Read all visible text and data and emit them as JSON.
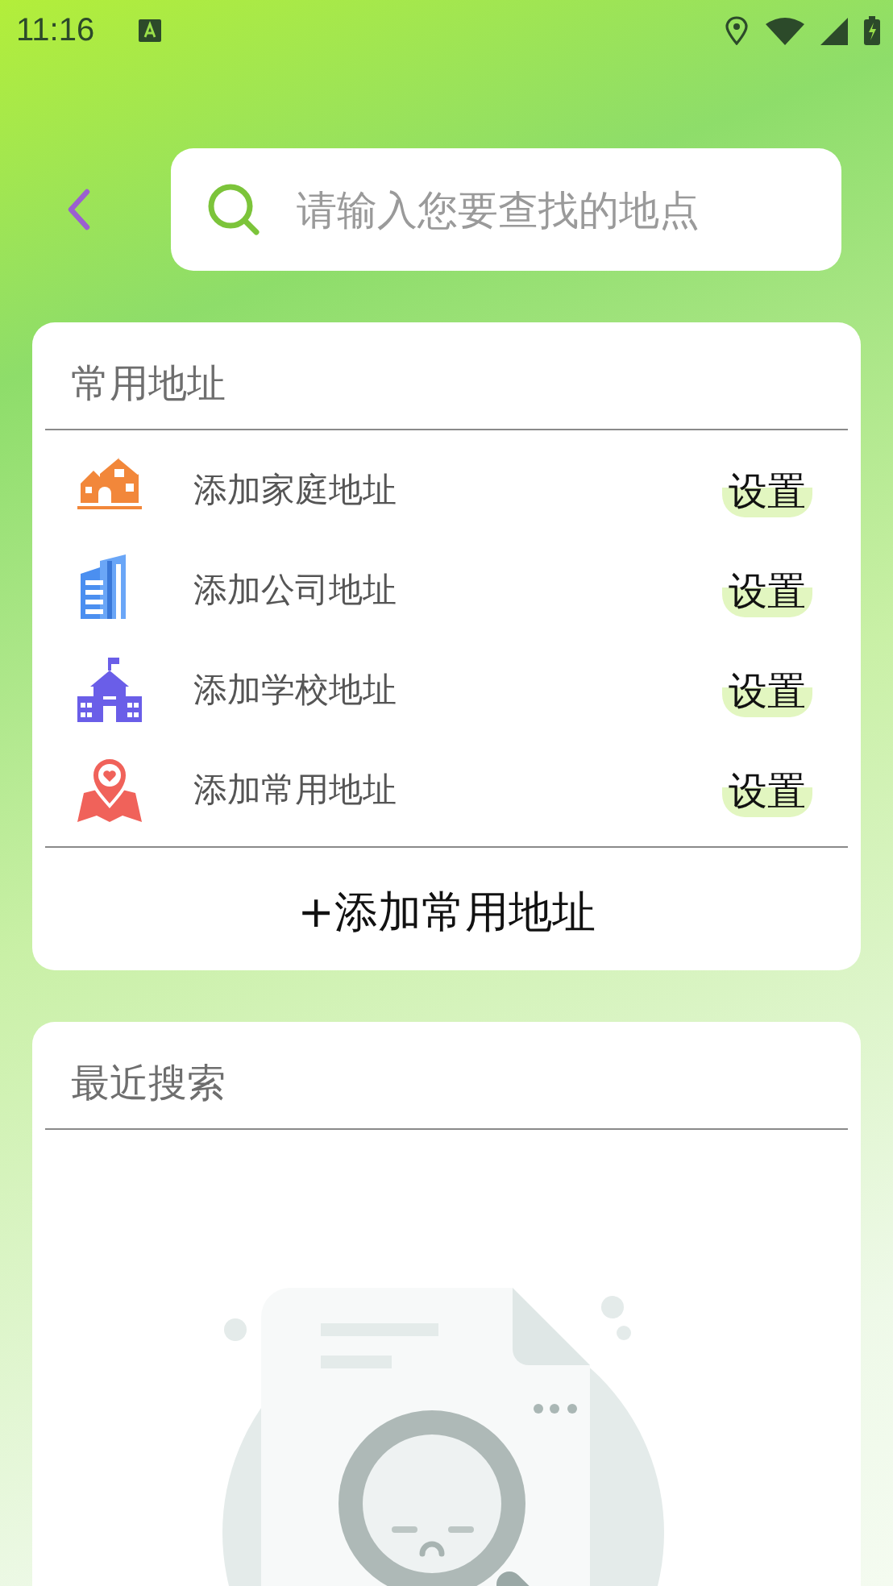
{
  "status_bar": {
    "time": "11:16"
  },
  "search": {
    "placeholder": "请输入您要查找的地点"
  },
  "frequent": {
    "title": "常用地址",
    "items": [
      {
        "kind": "home",
        "label": "添加家庭地址",
        "action": "设置"
      },
      {
        "kind": "company",
        "label": "添加公司地址",
        "action": "设置"
      },
      {
        "kind": "school",
        "label": "添加学校地址",
        "action": "设置"
      },
      {
        "kind": "place",
        "label": "添加常用地址",
        "action": "设置"
      }
    ],
    "add_button": "+添加常用地址"
  },
  "recent": {
    "title": "最近搜索"
  }
}
